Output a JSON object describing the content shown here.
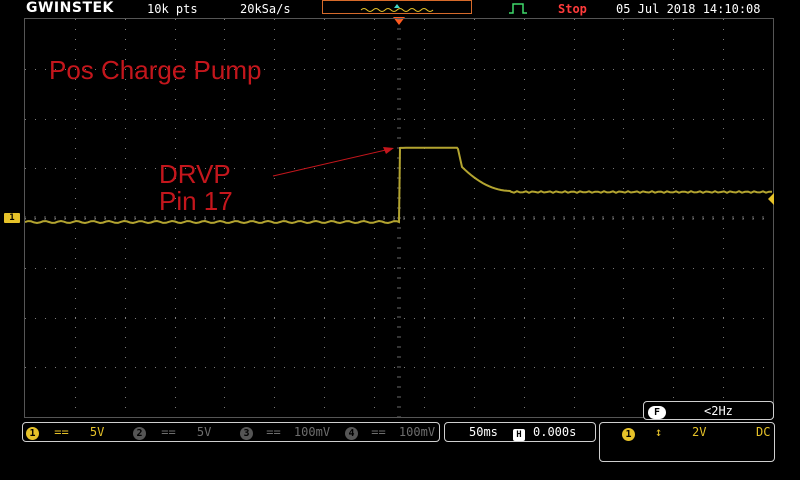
{
  "header": {
    "brand": "GWINSTEK",
    "record_length": "10k pts",
    "sample_rate": "20kSa/s",
    "run_state": "Stop",
    "datetime": "05 Jul 2018 14:10:08"
  },
  "annotations": {
    "title": "Pos Charge Pump",
    "label_line1": "DRVP",
    "label_line2": "Pin 17"
  },
  "channel_marker": {
    "label": "1"
  },
  "channels": [
    {
      "number": "1",
      "scale": "5V",
      "active": true
    },
    {
      "number": "2",
      "scale": "5V",
      "active": false
    },
    {
      "number": "3",
      "scale": "100mV",
      "active": false
    },
    {
      "number": "4",
      "scale": "100mV",
      "active": false
    }
  ],
  "horizontal": {
    "timebase": "50ms",
    "position": "0.000s"
  },
  "frequency": {
    "badge": "F",
    "value": "<2Hz"
  },
  "trigger": {
    "channel": "1",
    "level": "2V",
    "coupling": "DC"
  },
  "colors": {
    "channel1": "#e6c229",
    "trace": "#b3a430",
    "annotation": "#c4161c",
    "stop": "#ff3b3b"
  }
}
